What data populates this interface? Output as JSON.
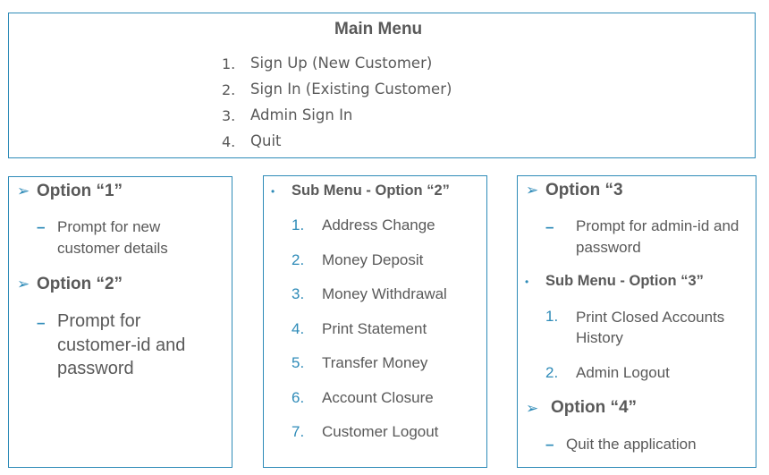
{
  "main_menu": {
    "title": "Main Menu",
    "items": [
      {
        "num": "1.",
        "label": "Sign Up (New Customer)"
      },
      {
        "num": "2.",
        "label": "Sign In (Existing Customer)"
      },
      {
        "num": "3.",
        "label": "Admin Sign In"
      },
      {
        "num": "4.",
        "label": "Quit"
      }
    ]
  },
  "left_panel": {
    "option1_heading": "Option “1”",
    "option1_detail": "Prompt for new customer details",
    "option2_heading": "Option “2”",
    "option2_detail": "Prompt for customer-id and password"
  },
  "middle_panel": {
    "heading": "Sub Menu - Option “2”",
    "items": [
      {
        "num": "1.",
        "label": "Address Change"
      },
      {
        "num": "2.",
        "label": "Money Deposit"
      },
      {
        "num": "3.",
        "label": "Money Withdrawal"
      },
      {
        "num": "4.",
        "label": "Print Statement"
      },
      {
        "num": "5.",
        "label": "Transfer Money"
      },
      {
        "num": "6.",
        "label": "Account Closure"
      },
      {
        "num": "7.",
        "label": "Customer Logout"
      }
    ]
  },
  "right_panel": {
    "option3_heading": "Option “3",
    "option3_detail": "Prompt for admin-id and password",
    "submenu_heading": "Sub Menu - Option “3”",
    "items": [
      {
        "num": "1.",
        "label": "Print Closed Accounts History"
      },
      {
        "num": "2.",
        "label": "Admin Logout"
      }
    ],
    "option4_heading": "Option “4”",
    "option4_detail": "Quit the application"
  },
  "symbols": {
    "arrow": "➢",
    "dash": "–",
    "bullet": "•"
  },
  "colors": {
    "border": "#2e8bb8",
    "accent": "#2e8bb8",
    "text": "#595959"
  }
}
